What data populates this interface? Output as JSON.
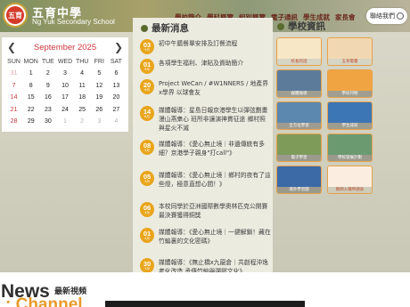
{
  "header": {
    "school_name_zh": "五育中學",
    "school_name_en": "Ng Yuk Secondary School",
    "logo_text": "五育",
    "nav": [
      "學校簡介",
      "學科概覽",
      "組別概覽",
      "電子通訊",
      "學生成就",
      "家長會"
    ],
    "contact_label": "聯絡我們"
  },
  "calendar": {
    "title": "September 2025",
    "prev_icon": "chevron-left-icon",
    "next_icon": "chevron-right-icon",
    "weekdays": [
      "SUN",
      "MON",
      "TUE",
      "WED",
      "THU",
      "FRI",
      "SAT"
    ],
    "weeks": [
      [
        "31",
        "1",
        "2",
        "3",
        "4",
        "5",
        "6"
      ],
      [
        "7",
        "8",
        "9",
        "10",
        "11",
        "12",
        "13"
      ],
      [
        "14",
        "15",
        "16",
        "17",
        "18",
        "19",
        "20"
      ],
      [
        "21",
        "22",
        "23",
        "24",
        "25",
        "26",
        "27"
      ],
      [
        "28",
        "29",
        "30",
        "1",
        "2",
        "3",
        "4"
      ]
    ]
  },
  "news": {
    "title": "最新消息",
    "items": [
      {
        "day": "03",
        "month": "9月",
        "text": "初中午膳餐單安排及訂餐流程"
      },
      {
        "day": "01",
        "month": "9月",
        "text": "各項學生福利、津貼及資助簡介"
      },
      {
        "day": "20",
        "month": "6月",
        "text": "Project WeCan / #W1NNERS / 地產界x學界 以球會友"
      },
      {
        "day": "14",
        "month": "6月",
        "text": "媒體報導：星島日報京港學生以彈弦劃畫漫山燕衆心 班所非讓演神貫征途 鄉村照與星火不滅"
      },
      {
        "day": "08",
        "month": "5月",
        "text": "媒體報導：《愛心無止境｜非遺傳統有多細？京港學子親身\"打call\"》"
      },
      {
        "day": "05",
        "month": "5月",
        "text": "媒體報導：《愛心無止境｜鄉村的夜有了這些燈，極意直想心間！》"
      },
      {
        "day": "06",
        "month": "4月",
        "text": "本校同學於亞洲國際數學奧林匹克公開賽最決賽獲得銅獎"
      },
      {
        "day": "01",
        "month": "4月",
        "text": "媒體報導：《愛心無止境｜一鍵解鎖！藏在竹編裏的文化密碼》"
      },
      {
        "day": "30",
        "month": "3月",
        "text": "媒體報導：《無止橋x九龍倉｜共創程沖逸老化改造 承傳竹編與彈膠文化》"
      }
    ]
  },
  "info": {
    "title": "學校資訊",
    "tiles": [
      {
        "label": "校長的話",
        "color": "#f7e7c6",
        "light": true
      },
      {
        "label": "五育電臺",
        "color": "#f2d8b2",
        "light": true
      },
      {
        "label": "媒體報導",
        "color": "#5c7b9b",
        "light": false
      },
      {
        "label": "學校刊物",
        "color": "#f0a542",
        "light": false
      },
      {
        "label": "全方位學習",
        "color": "#5c87ae",
        "light": false
      },
      {
        "label": "學生成就",
        "color": "#3d76b4",
        "light": false
      },
      {
        "label": "電子學習",
        "color": "#7f9b5a",
        "light": false
      },
      {
        "label": "學校發展計劃",
        "color": "#6b9a70",
        "light": false
      },
      {
        "label": "境外學習團",
        "color": "#3b6aa7",
        "light": false
      },
      {
        "label": "教師入職申請表",
        "color": "#fbeee0",
        "light": true
      }
    ]
  },
  "bottom": {
    "news_title": "News",
    "news_subtitle": "最新視頻",
    "channel_title": ": Channel"
  },
  "colors": {
    "accent_red": "#d1373f",
    "badge_orange": "#e9a51b",
    "tile_border": "#e7a14a",
    "nav_text": "#6b2a1e"
  }
}
